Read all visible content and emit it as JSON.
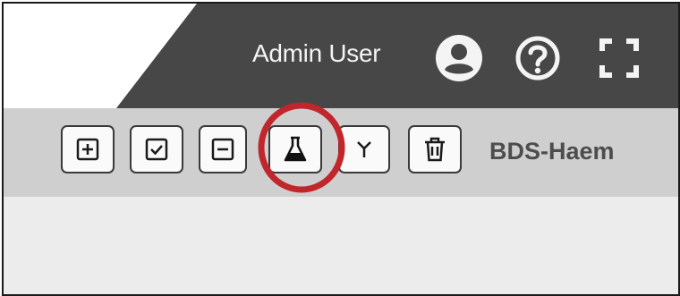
{
  "header": {
    "user_name": "Admin User",
    "icons": [
      "account-circle-icon",
      "help-circle-icon",
      "fullscreen-icon"
    ],
    "colors": {
      "bar": "#474747",
      "text": "#f4f4f4"
    }
  },
  "toolbar": {
    "buttons": [
      {
        "name": "add-button",
        "icon": "plus-square-icon"
      },
      {
        "name": "check-button",
        "icon": "check-square-icon"
      },
      {
        "name": "remove-button",
        "icon": "minus-square-icon"
      },
      {
        "name": "flask-button",
        "icon": "flask-icon"
      },
      {
        "name": "merge-button",
        "icon": "merge-icon"
      },
      {
        "name": "delete-button",
        "icon": "trash-icon"
      }
    ],
    "workspace_label": "BDS-Haem",
    "colors": {
      "background": "#cfcfcf",
      "button_bg": "#fafafa",
      "border": "#3a3a3a"
    }
  },
  "annotation": {
    "shape": "circle",
    "color": "#c0262b",
    "target": "flask-button"
  }
}
